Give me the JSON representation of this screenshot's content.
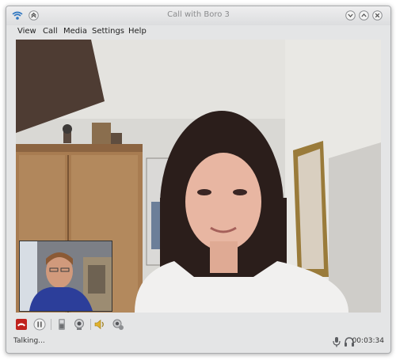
{
  "window": {
    "title": "Call with Boro 3"
  },
  "menu": [
    {
      "label": "View"
    },
    {
      "label": "Call"
    },
    {
      "label": "Media"
    },
    {
      "label": "Settings"
    },
    {
      "label": "Help"
    }
  ],
  "toolbar": {
    "buttons": [
      {
        "name": "hangup-icon",
        "color": "#c0221d"
      },
      {
        "name": "hold-icon"
      },
      {
        "name": "dialpad-icon"
      },
      {
        "name": "webcam-icon"
      },
      {
        "name": "volume-icon",
        "color": "#e0b22e"
      },
      {
        "name": "settings-webcam-icon"
      }
    ]
  },
  "status": {
    "text": "Talking...",
    "duration": "00:03:34"
  }
}
